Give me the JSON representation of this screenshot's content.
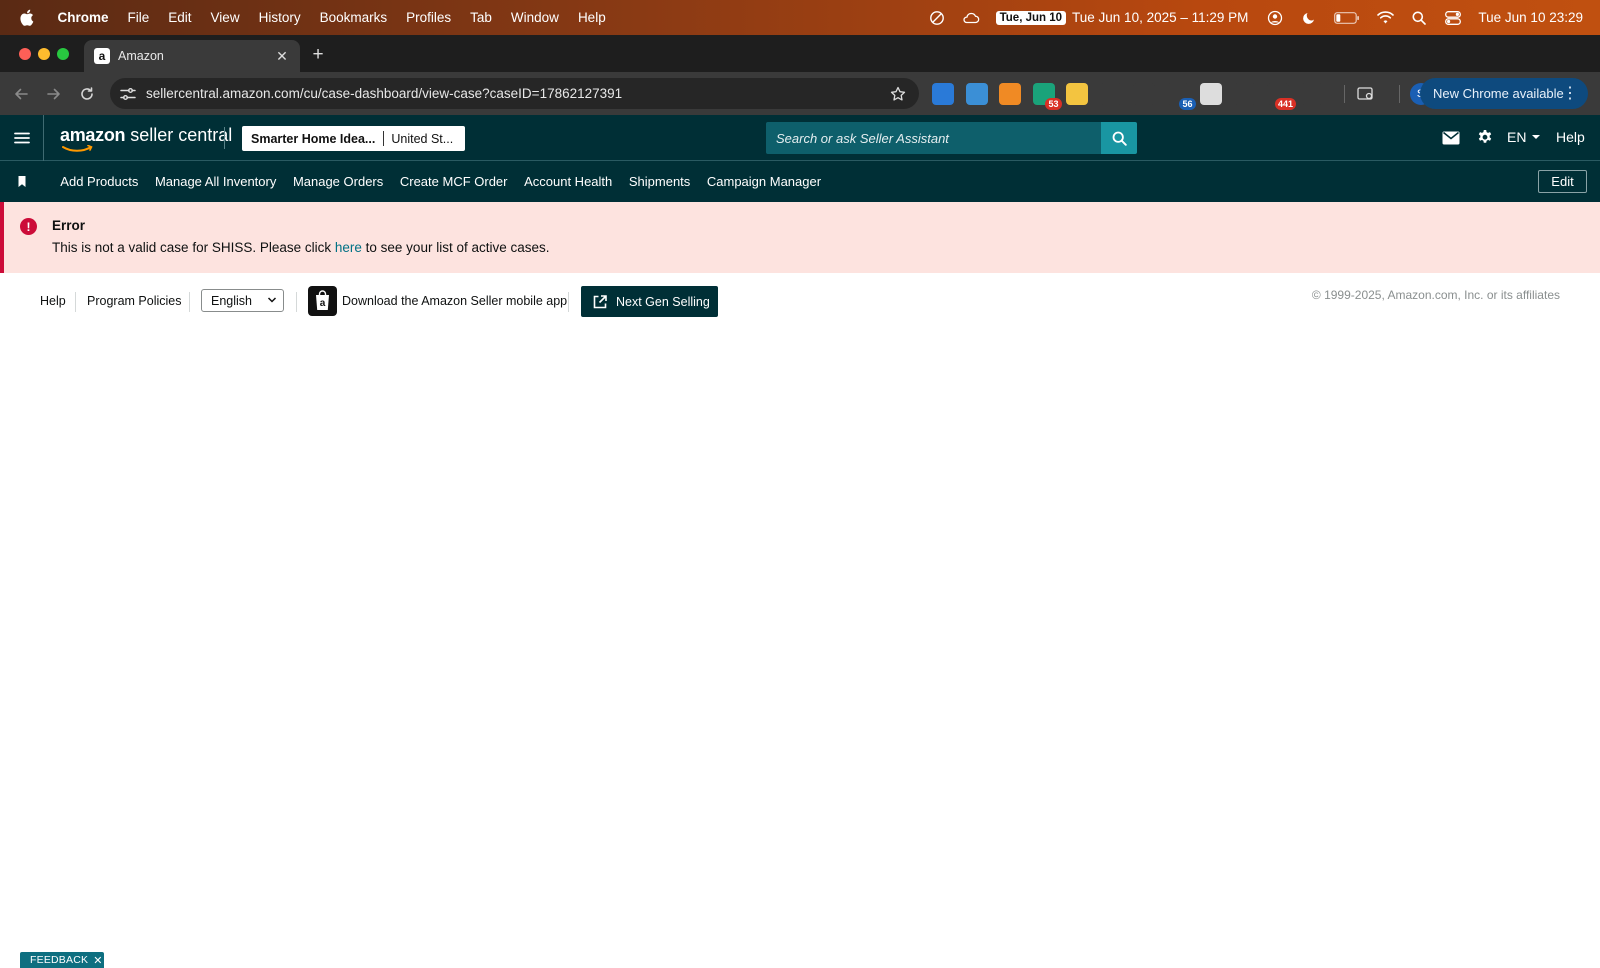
{
  "mac_menu": {
    "app": "Chrome",
    "items": [
      "File",
      "Edit",
      "View",
      "History",
      "Bookmarks",
      "Profiles",
      "Tab",
      "Window",
      "Help"
    ],
    "date_badge": "Tue, Jun 10",
    "datetime_text": "Tue Jun 10, 2025 – 11:29 PM",
    "clock": "Tue Jun 10  23:29"
  },
  "browser": {
    "tab_title": "Amazon",
    "url": "sellercentral.amazon.com/cu/case-dashboard/view-case?caseID=17862127391",
    "extensions": [
      {
        "name": "puzzle-grid-icon",
        "color": "#2a7ad8"
      },
      {
        "name": "map-icon",
        "color": "#3b8fd6"
      },
      {
        "name": "orange-ext-icon",
        "color": "#f08a24"
      },
      {
        "name": "green-ext-icon",
        "color": "#1aa37a",
        "badge": "53",
        "badge_color": "#d93025"
      },
      {
        "name": "yellow-ext-icon",
        "color": "#f3c440"
      },
      {
        "name": "pen-icon",
        "color": "#3a3a3a"
      },
      {
        "name": "camera-icon",
        "color": "#3a3a3a"
      },
      {
        "name": "red-ext-icon",
        "color": "#3a3a3a",
        "badge": "56",
        "badge_color": "#1a5fb4"
      },
      {
        "name": "s-circle-icon",
        "color": "#dddddd"
      },
      {
        "name": "doc-icon",
        "color": "#3a3a3a"
      },
      {
        "name": "calendar-ext-icon",
        "color": "#3a3a3a",
        "badge": "441",
        "badge_color": "#d93025"
      },
      {
        "name": "extensions-puzzle-icon",
        "color": "#3a3a3a"
      }
    ],
    "profile_initial": "S",
    "update_label": "New Chrome available"
  },
  "header": {
    "logo_brand": "amazon",
    "logo_product": "seller central",
    "account_name": "Smarter Home Idea...",
    "marketplace": "United St...",
    "search_placeholder": "Search or ask Seller Assistant",
    "language": "EN",
    "help_label": "Help"
  },
  "nav": {
    "links": [
      "Add Products",
      "Manage All Inventory",
      "Manage Orders",
      "Create MCF Order",
      "Account Health",
      "Shipments",
      "Campaign Manager"
    ],
    "edit_label": "Edit"
  },
  "error": {
    "title": "Error",
    "message_before": "This is not a valid case for SHISS. Please click ",
    "link_text": "here",
    "message_after": " to see your list of active cases."
  },
  "footer": {
    "help": "Help",
    "program_policies": "Program Policies",
    "language_selected": "English",
    "download_app": "Download the Amazon Seller mobile app",
    "next_gen": "Next Gen Selling",
    "copyright": "© 1999-2025, Amazon.com, Inc. or its affiliates"
  },
  "feedback_label": "FEEDBACK",
  "colors": {
    "header_bg": "#002f36",
    "search_bg": "#0e5f6b",
    "search_btn": "#1996a2",
    "error_bg": "#fde3df",
    "error_accent": "#cc0c39",
    "link": "#007185"
  }
}
